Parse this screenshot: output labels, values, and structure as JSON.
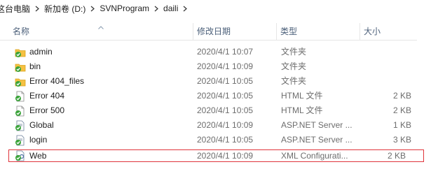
{
  "breadcrumb": [
    "这台电脑",
    "新加卷 (D:)",
    "SVNProgram",
    "daili"
  ],
  "columns": {
    "name": "名称",
    "modified": "修改日期",
    "type": "类型",
    "size": "大小"
  },
  "files": [
    {
      "name": "admin",
      "modified": "2020/4/1 10:07",
      "type": "文件夹",
      "size": "",
      "icon": "svn-folder-icon"
    },
    {
      "name": "bin",
      "modified": "2020/4/1 10:09",
      "type": "文件夹",
      "size": "",
      "icon": "svn-folder-icon"
    },
    {
      "name": "Error 404_files",
      "modified": "2020/4/1 10:05",
      "type": "文件夹",
      "size": "",
      "icon": "svn-folder-icon"
    },
    {
      "name": "Error 404",
      "modified": "2020/4/1 10:05",
      "type": "HTML 文件",
      "size": "2 KB",
      "icon": "svn-html-file-icon"
    },
    {
      "name": "Error 500",
      "modified": "2020/4/1 10:05",
      "type": "HTML 文件",
      "size": "2 KB",
      "icon": "svn-html-file-icon"
    },
    {
      "name": "Global",
      "modified": "2020/4/1 10:09",
      "type": "ASP.NET Server ...",
      "size": "1 KB",
      "icon": "svn-aspnet-file-icon"
    },
    {
      "name": "login",
      "modified": "2020/4/1 10:05",
      "type": "ASP.NET Server ...",
      "size": "3 KB",
      "icon": "svn-aspnet-file-icon"
    },
    {
      "name": "Web",
      "modified": "2020/4/1 10:09",
      "type": "XML Configurati...",
      "size": "2 KB",
      "icon": "svn-config-file-icon"
    }
  ],
  "colors": {
    "selection_outline": "#e0343b",
    "header_text": "#4c607a",
    "svn_badge": "#3aa339",
    "folder": "#f5c142"
  }
}
